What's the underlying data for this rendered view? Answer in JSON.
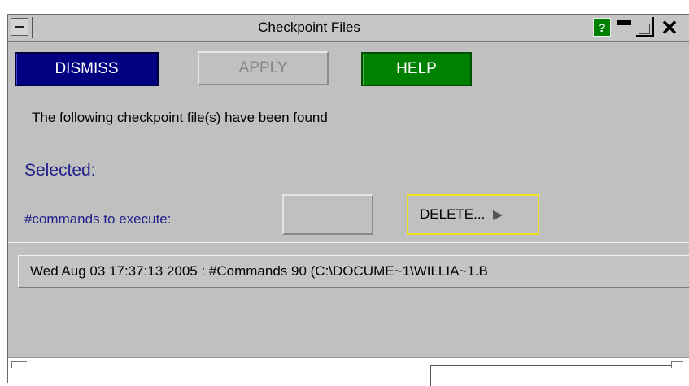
{
  "window": {
    "title": "Checkpoint Files",
    "help_glyph": "?"
  },
  "titlebar_icons": [
    "window-menu-icon",
    "help-icon",
    "minimize-icon",
    "maximize-icon",
    "close-icon"
  ],
  "buttons": {
    "dismiss": "DISMISS",
    "apply": "APPLY",
    "help": "HELP",
    "delete": "DELETE..."
  },
  "info": {
    "message": "The following checkpoint file(s) have been found",
    "selected_label": "Selected:",
    "commands_label": "#commands to execute:",
    "commands_value": ""
  },
  "files": [
    {
      "text": "Wed Aug 03 17:37:13 2005 : #Commands 90  (C:\\DOCUME~1\\WILLIA~1.B"
    }
  ],
  "colors": {
    "dismiss_bg": "#000080",
    "help_bg": "#008000",
    "delete_border": "#f0e020",
    "label_blue": "#20208a",
    "panel_bg": "#c0c0c0"
  }
}
